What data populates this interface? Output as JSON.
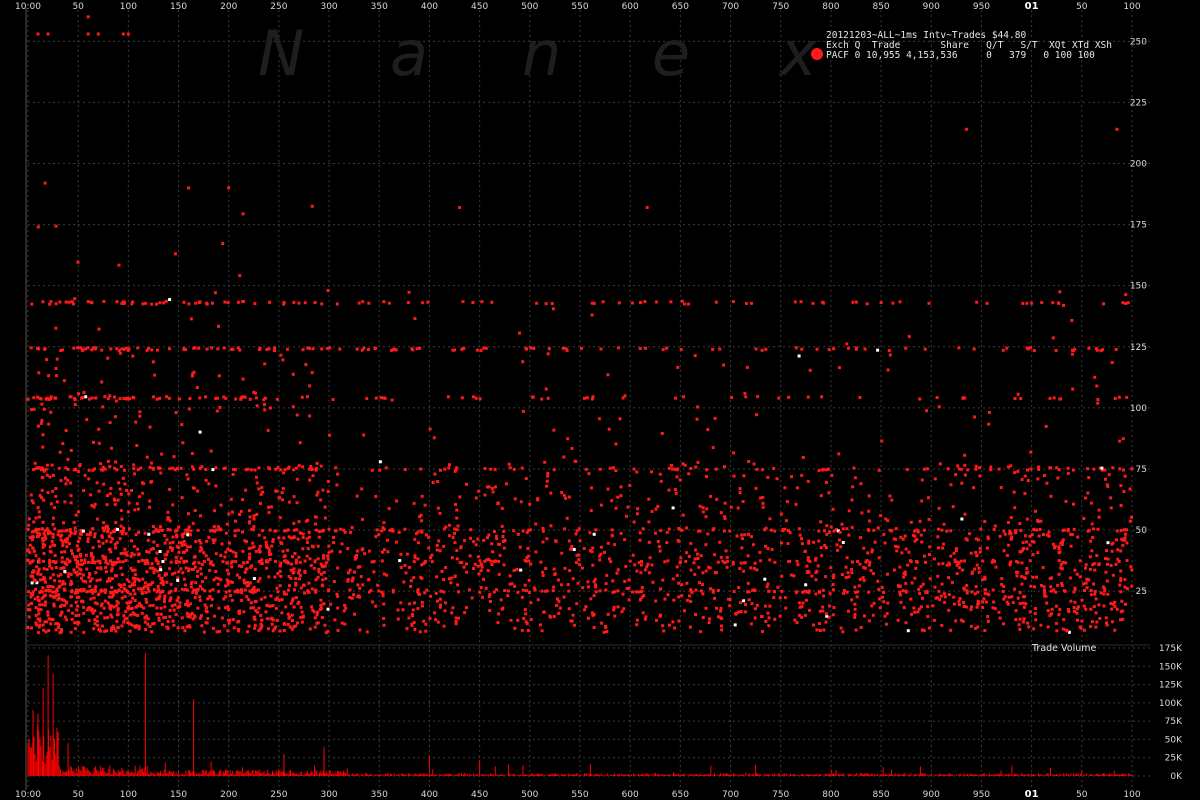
{
  "watermark_letters": [
    "N",
    "a",
    "n",
    "e",
    "x"
  ],
  "colors": {
    "background": "#000000",
    "trade_dot": "#ff1a1a",
    "highlight_dot": "#ffffff",
    "grid": "#3a3a3a",
    "volume": "#ff0000"
  },
  "legend": {
    "title": "20121203~ALL~1ms Intv~Trades $44.80",
    "header": "Exch Q  Trade       Share   Q/T   S/T  XQt XTd XSh",
    "row": "PACF 0 10,955 4,153,536     0   379   0 100 100",
    "marker_color": "#ff1a1a"
  },
  "volume_title": "Trade Volume",
  "chart_data": [
    {
      "type": "scatter",
      "title": "20121203~ALL~1ms Intv~Trades $44.80",
      "x_ticks": [
        "10:00",
        "50",
        "100",
        "150",
        "200",
        "250",
        "300",
        "350",
        "400",
        "450",
        "500",
        "550",
        "600",
        "650",
        "700",
        "750",
        "800",
        "850",
        "900",
        "950",
        "01",
        "50",
        "100"
      ],
      "x_tick_values": [
        0,
        50,
        100,
        150,
        200,
        250,
        300,
        350,
        400,
        450,
        500,
        550,
        600,
        650,
        700,
        750,
        800,
        850,
        900,
        950,
        1000,
        1050,
        1100
      ],
      "xlim": [
        0,
        1105
      ],
      "y_ticks": [
        "25",
        "50",
        "75",
        "100",
        "125",
        "150",
        "175",
        "200",
        "225",
        "250"
      ],
      "y_tick_values": [
        25,
        50,
        75,
        100,
        125,
        150,
        175,
        200,
        225,
        250
      ],
      "ylim": [
        5,
        262
      ],
      "series": [
        {
          "description": "Trades per 1ms interval (dense red dots)",
          "density_profile": [
            {
              "x_range": [
                0,
                30
              ],
              "weight": 1.0
            },
            {
              "x_range": [
                30,
                150
              ],
              "weight": 0.75
            },
            {
              "x_range": [
                150,
                300
              ],
              "weight": 0.55
            },
            {
              "x_range": [
                300,
                980
              ],
              "weight": 0.25
            },
            {
              "x_range": [
                980,
                1100
              ],
              "weight": 0.35
            }
          ],
          "horizontal_bands_y": [
            143,
            124,
            104,
            75,
            50,
            37,
            25
          ],
          "top_outliers": [
            {
              "x": 10,
              "y": 253
            },
            {
              "x": 20,
              "y": 253
            },
            {
              "x": 60,
              "y": 253
            },
            {
              "x": 70,
              "y": 253
            },
            {
              "x": 95,
              "y": 253
            },
            {
              "x": 100,
              "y": 253
            },
            {
              "x": 60,
              "y": 260
            },
            {
              "x": 935,
              "y": 214
            },
            {
              "x": 1085,
              "y": 214
            },
            {
              "x": 160,
              "y": 190
            },
            {
              "x": 200,
              "y": 190
            },
            {
              "x": 17,
              "y": 192
            },
            {
              "x": 430,
              "y": 182
            },
            {
              "x": 617,
              "y": 182
            }
          ]
        }
      ]
    },
    {
      "type": "bar",
      "title": "Trade Volume",
      "y_ticks": [
        "0K",
        "25K",
        "50K",
        "75K",
        "100K",
        "125K",
        "150K",
        "175K"
      ],
      "y_tick_values": [
        0,
        25000,
        50000,
        75000,
        100000,
        125000,
        150000,
        175000
      ],
      "ylim": [
        0,
        175000
      ],
      "spikes": [
        {
          "x": 5,
          "value": 90000
        },
        {
          "x": 10,
          "value": 85000
        },
        {
          "x": 15,
          "value": 120000
        },
        {
          "x": 20,
          "value": 165000
        },
        {
          "x": 25,
          "value": 140000
        },
        {
          "x": 30,
          "value": 60000
        },
        {
          "x": 40,
          "value": 45000
        },
        {
          "x": 117,
          "value": 168000
        },
        {
          "x": 165,
          "value": 105000
        },
        {
          "x": 255,
          "value": 30000
        },
        {
          "x": 295,
          "value": 40000
        },
        {
          "x": 400,
          "value": 28000
        },
        {
          "x": 450,
          "value": 22000
        }
      ]
    }
  ]
}
